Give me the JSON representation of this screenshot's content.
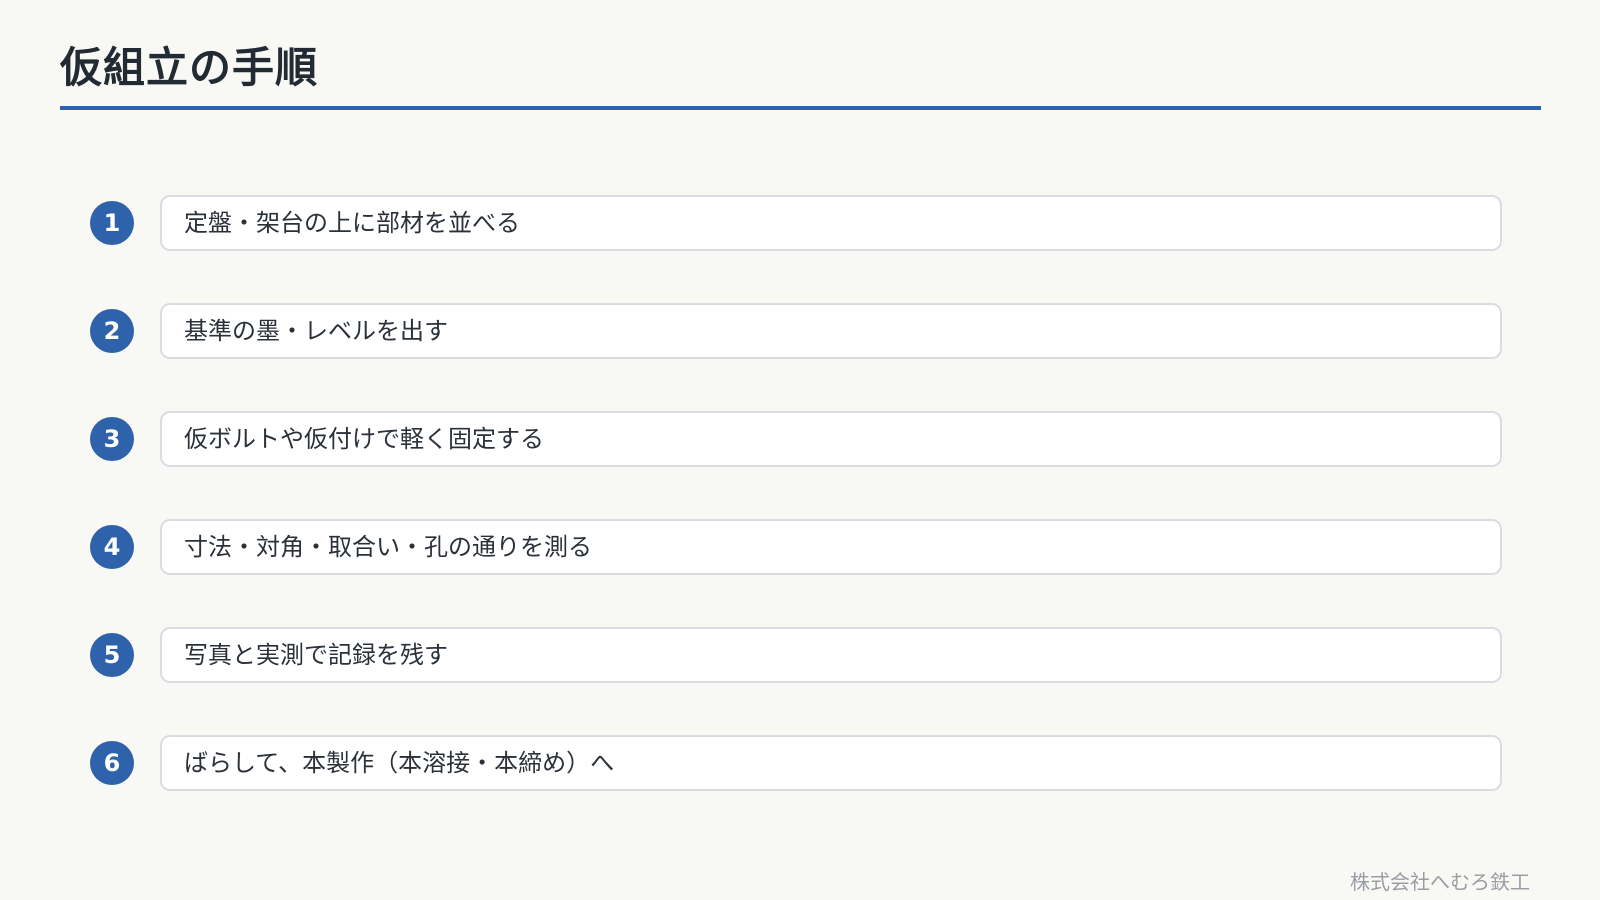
{
  "header": {
    "title": "仮組立の手順"
  },
  "steps": [
    {
      "number": "1",
      "text": "定盤・架台の上に部材を並べる"
    },
    {
      "number": "2",
      "text": "基準の墨・レベルを出す"
    },
    {
      "number": "3",
      "text": "仮ボルトや仮付けで軽く固定する"
    },
    {
      "number": "4",
      "text": "寸法・対角・取合い・孔の通りを測る"
    },
    {
      "number": "5",
      "text": "写真と実測で記録を残す"
    },
    {
      "number": "6",
      "text": "ばらして、本製作（本溶接・本締め）へ"
    }
  ],
  "footer": {
    "company": "株式会社へむろ鉄工"
  },
  "colors": {
    "accent": "#2e63ab",
    "background": "#f8f8f5",
    "box_border": "#d9dde3"
  }
}
